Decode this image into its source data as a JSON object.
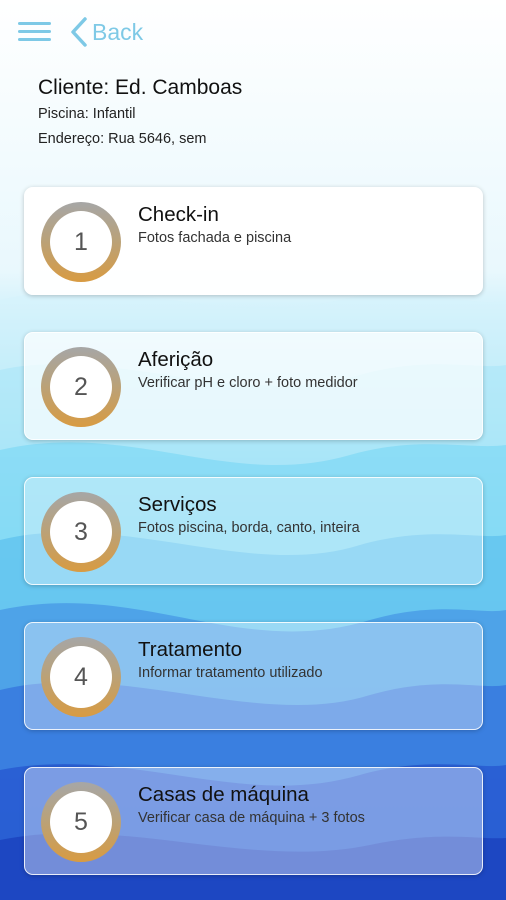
{
  "header": {
    "back_label": "Back"
  },
  "client": {
    "name": "Cliente: Ed. Camboas",
    "pool": "Piscina: Infantil",
    "address": "Endereço: Rua 5646, sem"
  },
  "steps": [
    {
      "number": "1",
      "title": "Check-in",
      "subtitle": "Fotos fachada e piscina"
    },
    {
      "number": "2",
      "title": "Aferição",
      "subtitle": "Verificar pH e cloro + foto medidor"
    },
    {
      "number": "3",
      "title": "Serviços",
      "subtitle": "Fotos piscina, borda, canto, inteira"
    },
    {
      "number": "4",
      "title": "Tratamento",
      "subtitle": "Informar tratamento utilizado"
    },
    {
      "number": "5",
      "title": "Casas de máquina",
      "subtitle": "Verificar casa de máquina + 3 fotos"
    }
  ],
  "colors": {
    "accent": "#7ec9e6",
    "ring_top": "#a6a6a6",
    "ring_bottom": "#d89b42"
  }
}
